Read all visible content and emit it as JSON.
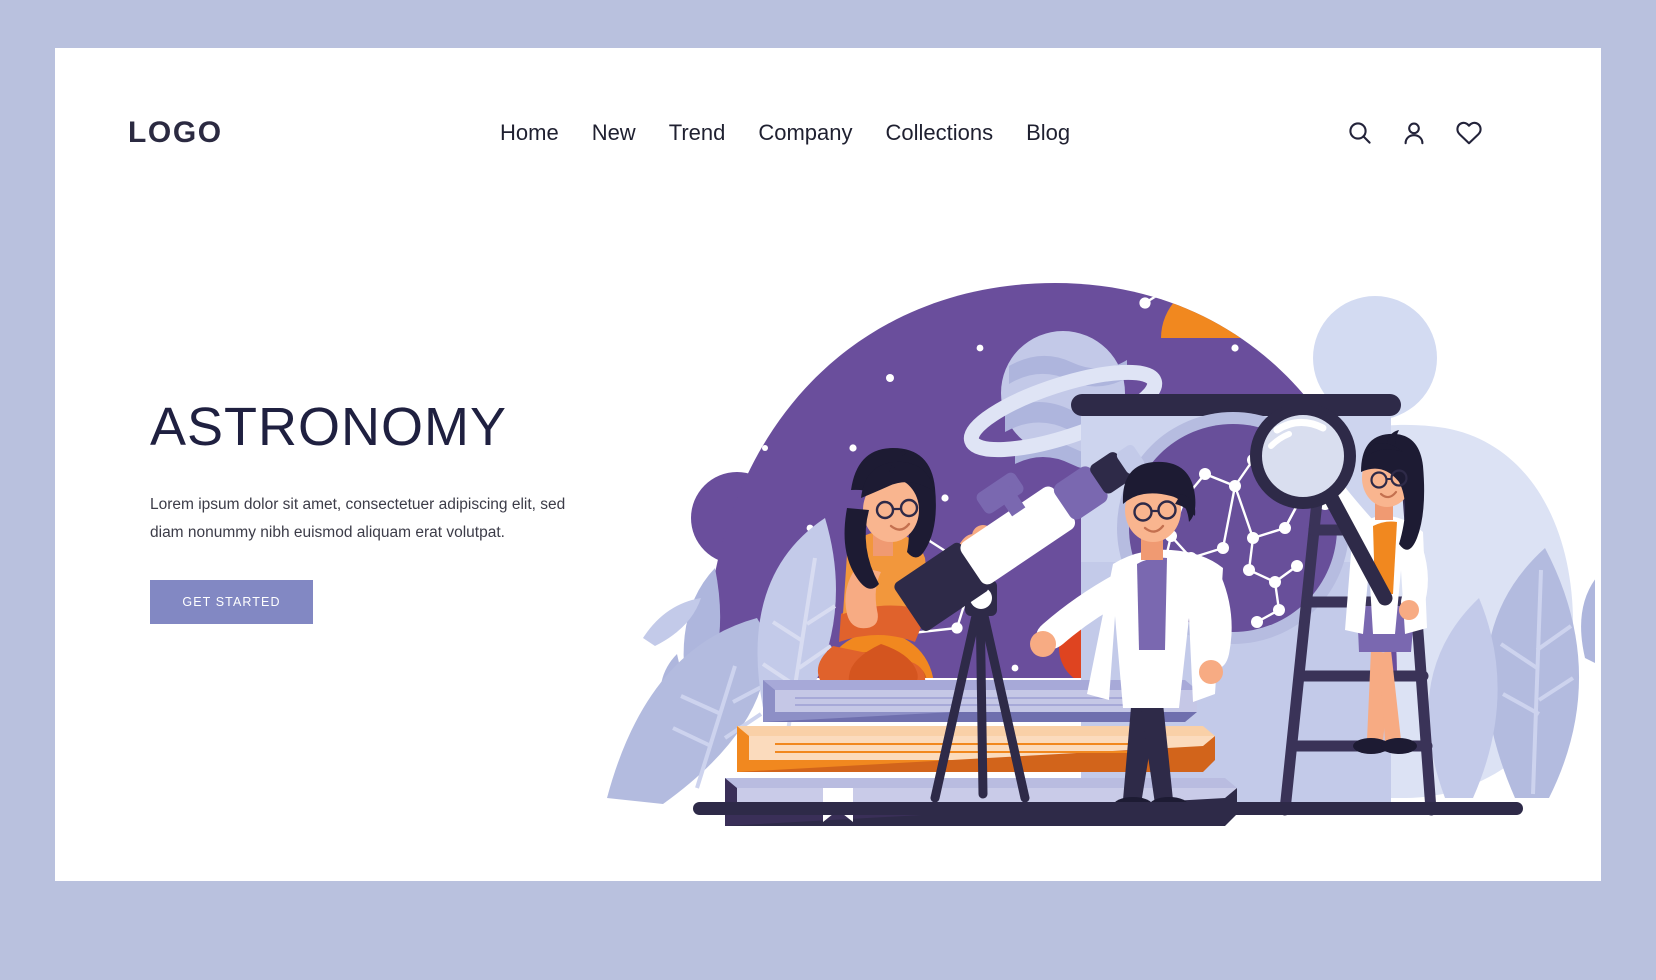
{
  "page": {
    "background_color": "#b9c1de",
    "card_color": "#ffffff"
  },
  "header": {
    "logo": "LOGO",
    "nav": [
      {
        "label": "Home"
      },
      {
        "label": "New"
      },
      {
        "label": "Trend"
      },
      {
        "label": "Company"
      },
      {
        "label": "Collections"
      },
      {
        "label": "Blog"
      }
    ],
    "icons": [
      {
        "name": "search-icon"
      },
      {
        "name": "user-icon"
      },
      {
        "name": "heart-icon"
      }
    ]
  },
  "hero": {
    "title": "ASTRONOMY",
    "subtitle": "Lorem ipsum dolor sit amet, consectetuer adipiscing elit, sed diam nonummy nibh euismod aliquam erat volutpat.",
    "cta_label": "GET STARTED",
    "cta_color": "#8288c3",
    "title_color": "#1f2040"
  },
  "illustration": {
    "name": "astronomy-scene",
    "colors": {
      "night_dome": "#6a4e9c",
      "night_dome_deep": "#5b4189",
      "orange": "#f1881f",
      "orange_dark": "#d2641b",
      "red_planet": "#df4420",
      "lavender": "#b9c1e4",
      "light_lavender": "#d6dcf0",
      "pale": "#e8ecf8",
      "dark_navy": "#2e2a48",
      "white": "#ffffff",
      "skin": "#f7ab83",
      "leaf": "#aeb6dd"
    },
    "elements": [
      {
        "name": "night-sky-dome"
      },
      {
        "name": "saturn-planet"
      },
      {
        "name": "jupiter-planet"
      },
      {
        "name": "red-planet"
      },
      {
        "name": "orange-sun"
      },
      {
        "name": "purple-circle"
      },
      {
        "name": "pale-circle"
      },
      {
        "name": "constellations"
      },
      {
        "name": "whiteboard"
      },
      {
        "name": "constellation-chart"
      },
      {
        "name": "telescope"
      },
      {
        "name": "scientist-man"
      },
      {
        "name": "scientist-woman-ladder"
      },
      {
        "name": "woman-on-books"
      },
      {
        "name": "book-stack"
      },
      {
        "name": "magnifying-glass"
      },
      {
        "name": "ladder"
      },
      {
        "name": "leaves"
      },
      {
        "name": "ground-line"
      }
    ]
  }
}
